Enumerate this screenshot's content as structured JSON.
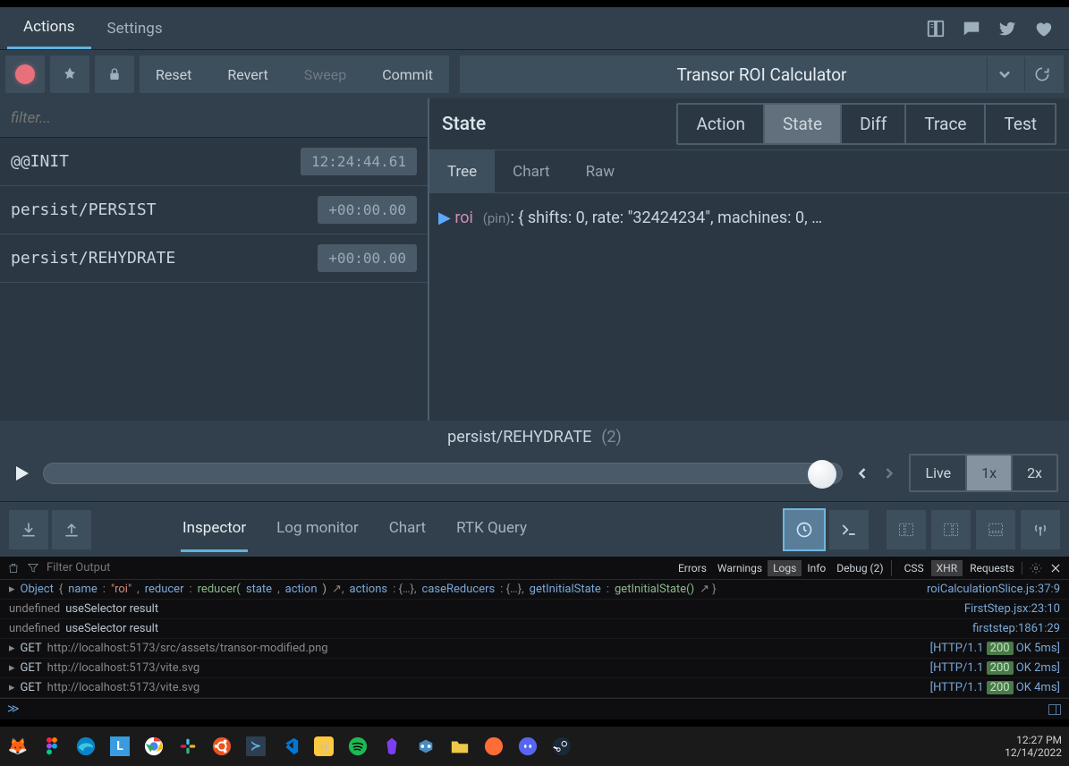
{
  "header": {
    "tabs": [
      "Actions",
      "Settings"
    ]
  },
  "toolbar": {
    "reset": "Reset",
    "revert": "Revert",
    "sweep": "Sweep",
    "commit": "Commit"
  },
  "app_title": "Transor ROI Calculator",
  "filter_placeholder": "filter...",
  "actions": [
    {
      "name": "@@INIT",
      "time": "12:24:44.61"
    },
    {
      "name": "persist/PERSIST",
      "time": "+00:00.00"
    },
    {
      "name": "persist/REHYDRATE",
      "time": "+00:00.00"
    }
  ],
  "state_panel": {
    "title": "State",
    "tabs": [
      "Action",
      "State",
      "Diff",
      "Trace",
      "Test"
    ],
    "subtabs": [
      "Tree",
      "Chart",
      "Raw"
    ]
  },
  "tree": {
    "key": "roi",
    "pin": "(pin)",
    "value": ": { shifts: 0, rate: \"32424234\", machines: 0, …"
  },
  "timeline": {
    "label": "persist/REHYDRATE",
    "count": "(2)",
    "speeds": [
      "Live",
      "1x",
      "2x"
    ]
  },
  "bottombar": {
    "tabs": [
      "Inspector",
      "Log monitor",
      "Chart",
      "RTK Query"
    ]
  },
  "console": {
    "filter_placeholder": "Filter Output",
    "pills": [
      "Errors",
      "Warnings",
      "Logs",
      "Info",
      "Debug (2)"
    ],
    "sections": [
      "CSS",
      "XHR",
      "Requests"
    ],
    "rows": [
      {
        "type": "obj",
        "src": "roiCalculationSlice.js",
        "loc": "37:9"
      },
      {
        "type": "text",
        "pre": "undefined",
        "msg": "useSelector result",
        "src": "FirstStep.jsx",
        "loc": "23:10"
      },
      {
        "type": "text",
        "pre": "undefined",
        "msg": "useSelector result",
        "src": "firststep",
        "loc": "1861:29"
      },
      {
        "type": "get",
        "url": "http://localhost:5173/src/assets/transor-modified.png",
        "proto": "[HTTP/1.1",
        "status": "200",
        "rest": "OK 5ms]"
      },
      {
        "type": "get",
        "url": "http://localhost:5173/vite.svg",
        "proto": "[HTTP/1.1",
        "status": "200",
        "rest": "OK 2ms]"
      },
      {
        "type": "get",
        "url": "http://localhost:5173/vite.svg",
        "proto": "[HTTP/1.1",
        "status": "200",
        "rest": "OK 4ms]"
      }
    ]
  },
  "obj_row": {
    "label": "Object",
    "open": "{ ",
    "k1": "name",
    "v1": "\"roi\"",
    "k2": "reducer",
    "v2a": "reducer(",
    "v2b": "state",
    "v2c": ", ",
    "v2d": "action",
    "v2e": ")",
    "k3": "actions",
    "v3": "{…}",
    "k4": "caseReducers",
    "v4": "{…}",
    "k5": "getInitialState",
    "v5": "getInitialState()",
    "close": " }"
  },
  "clock": {
    "time": "12:27 PM",
    "date": "12/14/2022"
  }
}
